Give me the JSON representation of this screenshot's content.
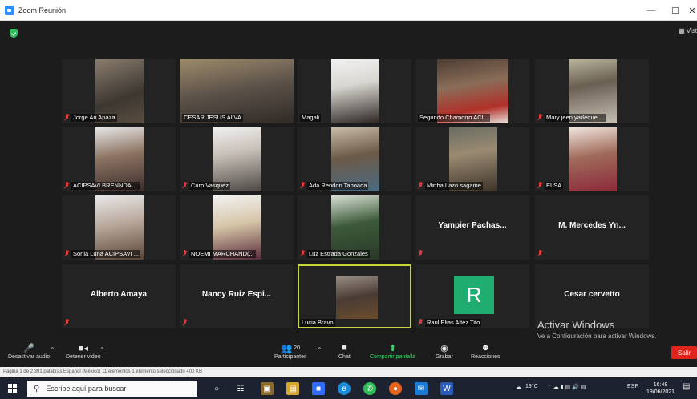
{
  "window": {
    "title": "Zoom Reunión",
    "minimize": "—",
    "maximize": "☐",
    "close": "✕"
  },
  "meeting": {
    "view_label": "Vist"
  },
  "participants": [
    {
      "name": "Jorge Ari Apaza",
      "muted": true,
      "video": true
    },
    {
      "name": "CESAR JESUS ALVA",
      "muted": false,
      "video": true
    },
    {
      "name": "Magali",
      "muted": false,
      "video": true
    },
    {
      "name": "Segundo Chamorro ACI...",
      "muted": false,
      "video": true
    },
    {
      "name": "Mary jeen yarleque ...",
      "muted": true,
      "video": true
    },
    {
      "name": "ACIPSAVI BRENNDA ...",
      "muted": true,
      "video": true
    },
    {
      "name": "Curo Vasquez",
      "muted": true,
      "video": true
    },
    {
      "name": "Ada Rendon Taboada",
      "muted": true,
      "video": true
    },
    {
      "name": "Mirtha Lazo sagame",
      "muted": true,
      "video": true
    },
    {
      "name": "ELSA",
      "muted": true,
      "video": true
    },
    {
      "name": "Sonia Luna ACIPSAVI ...",
      "muted": true,
      "video": true
    },
    {
      "name": "NOEMI MARCHAND(...",
      "muted": true,
      "video": true
    },
    {
      "name": "Luz Estrada Gonzales",
      "muted": true,
      "video": true
    },
    {
      "name": "Yampier Pachas...",
      "muted": true,
      "video": false
    },
    {
      "name": "M. Mercedes Yn...",
      "muted": true,
      "video": false
    },
    {
      "name": "Alberto Amaya",
      "muted": true,
      "video": false
    },
    {
      "name": "Nancy Ruiz Espi...",
      "muted": true,
      "video": false
    },
    {
      "name": "Lucia Bravo",
      "muted": false,
      "video": true,
      "active": true
    },
    {
      "name": "Raul Elias Altez Tito",
      "muted": true,
      "video": false,
      "avatar_letter": "R"
    },
    {
      "name": "Cesar cervetto",
      "muted": false,
      "video": false
    }
  ],
  "watermark": {
    "line1": "Activar Windows",
    "line2": "Ve a Configuración para activar Windows."
  },
  "toolbar": {
    "audio_label": "Desactivar audio",
    "video_label": "Detener video",
    "participants_label": "Participantes",
    "participants_count": "20",
    "chat_label": "Chat",
    "share_label": "Compartir pantalla",
    "record_label": "Grabar",
    "reactions_label": "Reacciones",
    "leave_label": "Salir"
  },
  "behind_window": {
    "status_text": "Página 1 de 2   391 palabras   Español (México)      11 elementos    1 elemento seleccionado  400 KB"
  },
  "taskbar": {
    "search_placeholder": "Escribe aquí para buscar",
    "weather": "19°C",
    "language": "ESP",
    "time": "16:48",
    "date": "19/06/2021"
  },
  "colors": {
    "active_speaker": "#c8d43e",
    "leave": "#e0251c",
    "avatar": "#1fae70",
    "mute": "#e03a3a"
  }
}
